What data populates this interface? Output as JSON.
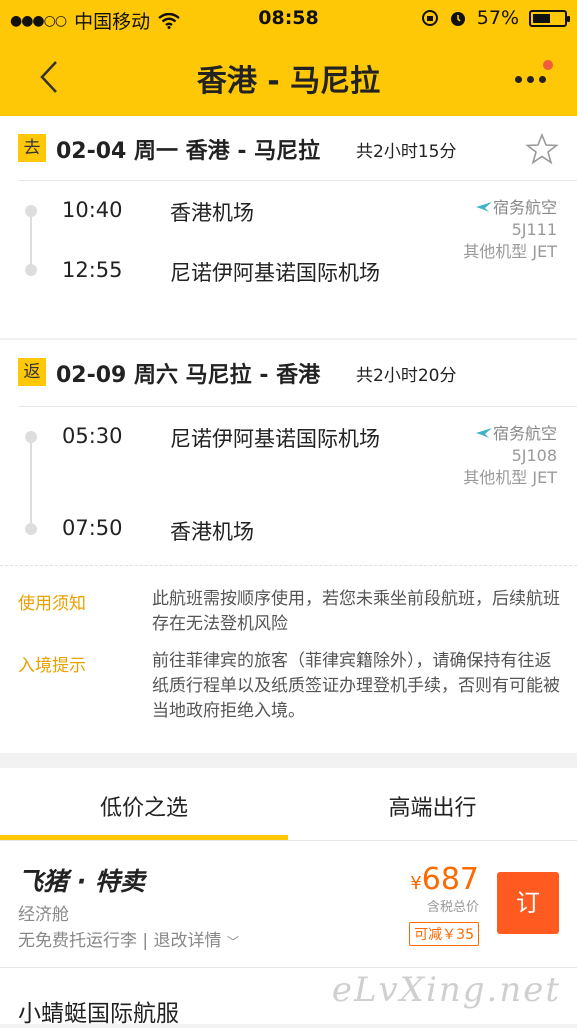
{
  "status_bar": {
    "carrier": "中国移动",
    "time": "08:58",
    "battery": "57%",
    "battery_level": 0.57
  },
  "nav": {
    "title": "香港 - 马尼拉"
  },
  "outbound": {
    "tag": "去",
    "title": "02-04 周一 香港 - 马尼拉",
    "duration": "共2小时15分",
    "dep_time": "10:40",
    "dep_airport": "香港机场",
    "arr_time": "12:55",
    "arr_airport": "尼诺伊阿基诺国际机场",
    "airline": "宿务航空",
    "flight_no": "5J111",
    "aircraft": "其他机型 JET"
  },
  "return": {
    "tag": "返",
    "title": "02-09 周六 马尼拉 - 香港",
    "duration": "共2小时20分",
    "dep_time": "05:30",
    "dep_airport": "尼诺伊阿基诺国际机场",
    "arr_time": "07:50",
    "arr_airport": "香港机场",
    "airline": "宿务航空",
    "flight_no": "5J108",
    "aircraft": "其他机型 JET"
  },
  "notes": [
    {
      "label": "使用须知",
      "text": "此航班需按顺序使用，若您未乘坐前段航班，后续航班存在无法登机风险"
    },
    {
      "label": "入境提示",
      "text": "前往菲律宾的旅客（菲律宾籍除外），请确保持有往返纸质行程单以及纸质签证办理登机手续，否则有可能被当地政府拒绝入境。"
    }
  ],
  "tabs": [
    {
      "label": "低价之选",
      "active": true
    },
    {
      "label": "高端出行",
      "active": false
    }
  ],
  "offers": [
    {
      "brand": "飞猪 · 特卖",
      "cabin": "经济舱",
      "baggage": "无免费托运行李 | 退改详情",
      "currency": "¥",
      "price": "687",
      "tax_note": "含税总价",
      "discount": "可减￥35",
      "book_label": "订"
    },
    {
      "brand": "小蜻蜓国际航服"
    }
  ],
  "watermark": "eLvXing.net",
  "colors": {
    "header": "#ffc807",
    "accent": "#ff6a00",
    "book_button": "#ff5a1f",
    "note_label": "#e8a100"
  },
  "icons": [
    "back-chevron-icon",
    "more-dots-icon",
    "star-icon",
    "wifi-icon",
    "airline-logo-icon"
  ]
}
